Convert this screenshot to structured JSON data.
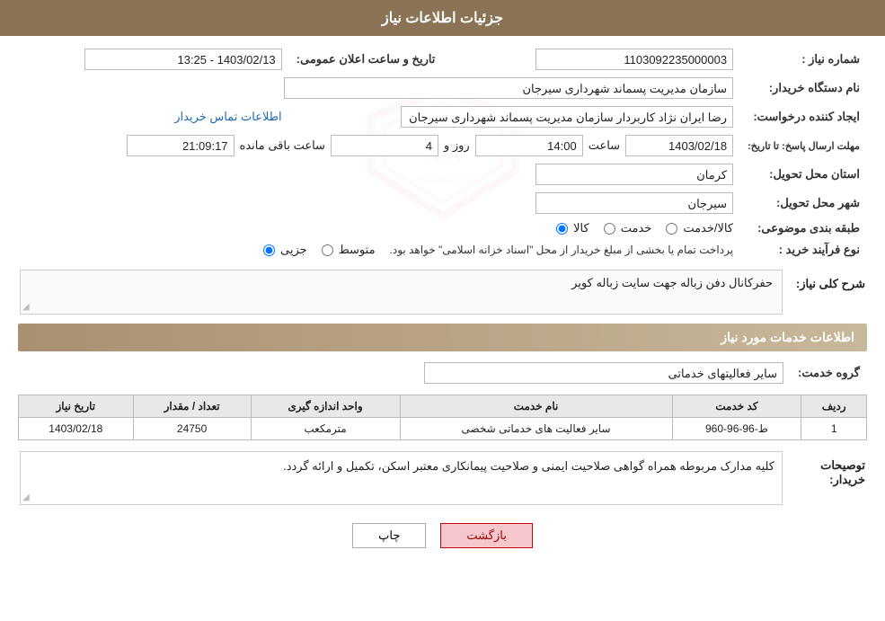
{
  "header": {
    "title": "جزئیات اطلاعات نیاز"
  },
  "fields": {
    "need_number_label": "شماره نیاز :",
    "need_number_value": "1103092235000003",
    "org_label": "نام دستگاه خریدار:",
    "org_value": "سازمان مدیریت پسماند شهرداری سیرجان",
    "creator_label": "ایجاد کننده درخواست:",
    "creator_value": "رضا ایران نژاد کاربردار سازمان مدیریت پسماند شهرداری سیرجان",
    "creator_link": "اطلاعات تماس خریدار",
    "date_label": "مهلت ارسال پاسخ: تا تاریخ:",
    "date_value": "1403/02/18",
    "time_label": "ساعت",
    "time_value": "14:00",
    "days_label": "روز و",
    "days_value": "4",
    "remaining_label": "ساعت باقی مانده",
    "remaining_value": "21:09:17",
    "announce_label": "تاریخ و ساعت اعلان عمومی:",
    "announce_value": "1403/02/13 - 13:25",
    "province_label": "استان محل تحویل:",
    "province_value": "کرمان",
    "city_label": "شهر محل تحویل:",
    "city_value": "سیرجان",
    "category_label": "طبقه بندی موضوعی:",
    "radio_kala": "کالا",
    "radio_khedmat": "خدمت",
    "radio_kala_khedmat": "کالا/خدمت",
    "process_label": "نوع فرآیند خرید :",
    "radio_jozi": "جزیی",
    "radio_mottaset": "متوسط",
    "process_note": "پرداخت تمام یا بخشی از مبلغ خریدار از محل \"اسناد خزانه اسلامی\" خواهد بود.",
    "need_desc_label": "شرح کلی نیاز:",
    "need_desc_value": "حفرکانال دفن زباله جهت سایت زباله کویر",
    "services_section_label": "اطلاعات خدمات مورد نیاز",
    "service_group_label": "گروه خدمت:",
    "service_group_value": "سایر فعالیتهای خدماتی",
    "table_headers": {
      "row_num": "ردیف",
      "service_code": "کد خدمت",
      "service_name": "نام خدمت",
      "unit": "واحد اندازه گیری",
      "quantity": "تعداد / مقدار",
      "date": "تاریخ نیاز"
    },
    "table_rows": [
      {
        "row_num": "1",
        "service_code": "ط-96-96-960",
        "service_name": "سایر فعالیت های خدماتی شخصی",
        "unit": "مترمکعب",
        "quantity": "24750",
        "date": "1403/02/18"
      }
    ],
    "buyer_desc_label": "توصیحات خریدار:",
    "buyer_desc_value": "کلیه مدارک مربوطه همراه گواهی صلاحیت ایمنی و صلاحیت پیمانکاری معتبر  اسکن، تکمیل و ارائه گردد.",
    "btn_back": "بازگشت",
    "btn_print": "چاپ"
  }
}
